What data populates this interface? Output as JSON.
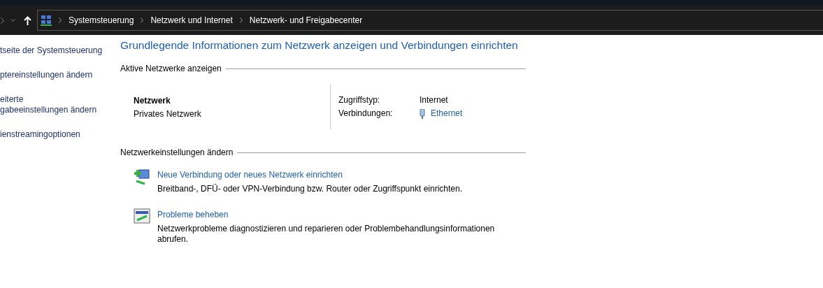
{
  "address_bar": {
    "crumbs": [
      "Systemsteuerung",
      "Netzwerk und Internet",
      "Netzwerk- und Freigabecenter"
    ]
  },
  "sidebar": {
    "links": [
      {
        "lines": [
          "tseite der Systemsteuerung"
        ]
      },
      {
        "lines": [
          "ptereinstellungen ändern"
        ]
      },
      {
        "lines": [
          "eiterte",
          "gabeeinstellungen ändern"
        ]
      },
      {
        "lines": [
          "ienstreamingoptionen"
        ]
      }
    ]
  },
  "title": "Grundlegende Informationen zum Netzwerk anzeigen und Verbindungen einrichten",
  "active_networks": {
    "heading": "Aktive Netzwerke anzeigen",
    "name": "Netzwerk",
    "category": "Privates Netzwerk",
    "properties": [
      {
        "label": "Zugriffstyp:",
        "value": "Internet",
        "kind": "text"
      },
      {
        "label": "Verbindungen:",
        "value": "Ethernet",
        "kind": "link"
      }
    ]
  },
  "change_settings": {
    "heading": "Netzwerkeinstellungen ändern",
    "tasks": [
      {
        "kind": "new-connection",
        "link": "Neue Verbindung oder neues Netzwerk einrichten",
        "description": "Breitband-, DFÜ- oder VPN-Verbindung bzw. Router oder Zugriffspunkt einrichten."
      },
      {
        "kind": "troubleshoot",
        "link": "Probleme beheben",
        "description": "Netzwerkprobleme diagnostizieren und reparieren oder Problembehandlungsinformationen abrufen."
      }
    ]
  }
}
